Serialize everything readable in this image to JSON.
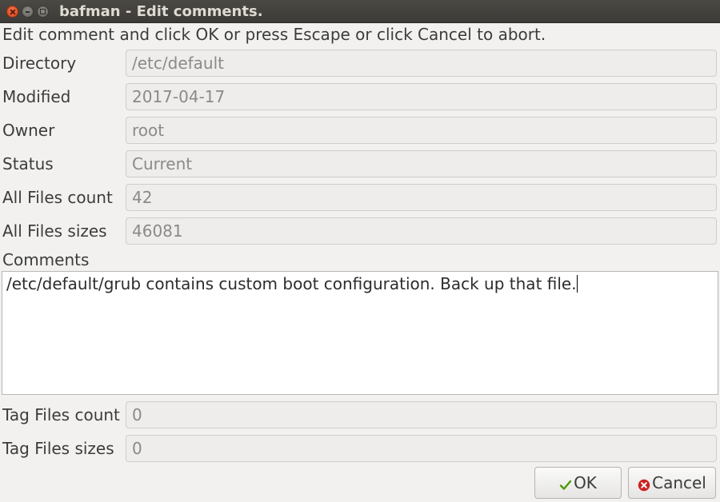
{
  "window": {
    "title": "bafman - Edit comments."
  },
  "instruction": "Edit comment and click OK or press Escape or click Cancel to abort.",
  "fields": [
    {
      "label": "Directory",
      "value": "/etc/default"
    },
    {
      "label": "Modified",
      "value": "2017-04-17"
    },
    {
      "label": "Owner",
      "value": "root"
    },
    {
      "label": "Status",
      "value": "Current"
    },
    {
      "label": "All Files count",
      "value": "42"
    },
    {
      "label": "All Files sizes",
      "value": "46081"
    }
  ],
  "comments": {
    "label": "Comments",
    "value": "/etc/default/grub contains custom boot configuration. Back up that file."
  },
  "tag_fields": [
    {
      "label": "Tag Files count",
      "value": "0"
    },
    {
      "label": "Tag Files sizes",
      "value": "0"
    }
  ],
  "buttons": {
    "ok_label": "OK",
    "ok_icon": "checkmark-icon",
    "cancel_label": "Cancel",
    "cancel_icon": "cancel-icon"
  },
  "colors": {
    "titlebar": "#3c3b37",
    "close_button": "#e95420",
    "background": "#f2f1f0",
    "ok_check": "#4e9a06",
    "cancel_icon": "#cc2222"
  }
}
